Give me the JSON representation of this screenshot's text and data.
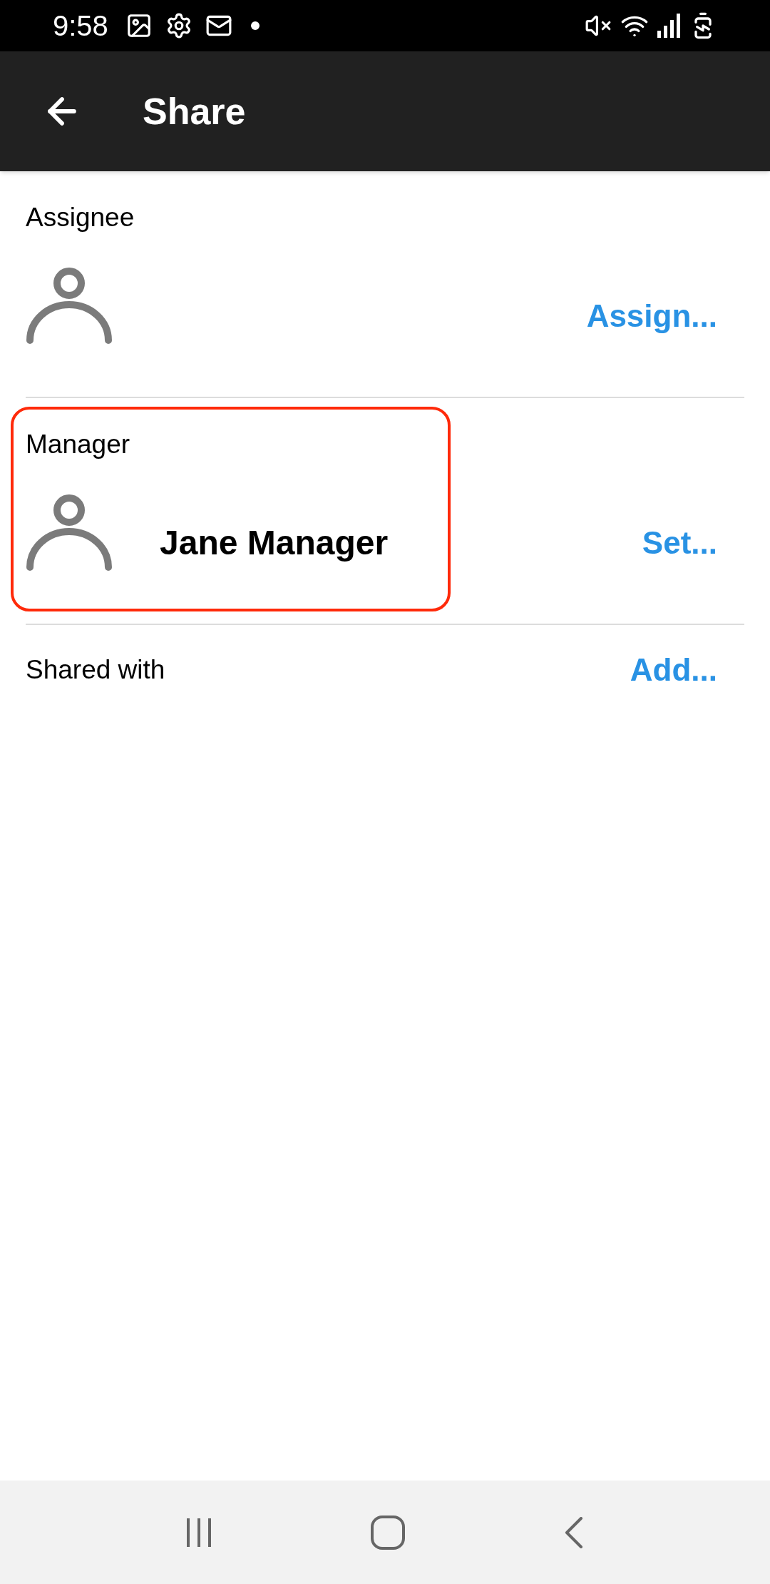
{
  "status_bar": {
    "time": "9:58"
  },
  "app_bar": {
    "title": "Share"
  },
  "sections": [
    {
      "kind": "person",
      "label": "Assignee",
      "action": "Assign...",
      "highlighted": false
    },
    {
      "kind": "person",
      "label": "Manager",
      "name": "Jane Manager",
      "action": "Set...",
      "highlighted": true
    },
    {
      "kind": "list",
      "label": "Shared with",
      "action": "Add...",
      "highlighted": false
    }
  ]
}
